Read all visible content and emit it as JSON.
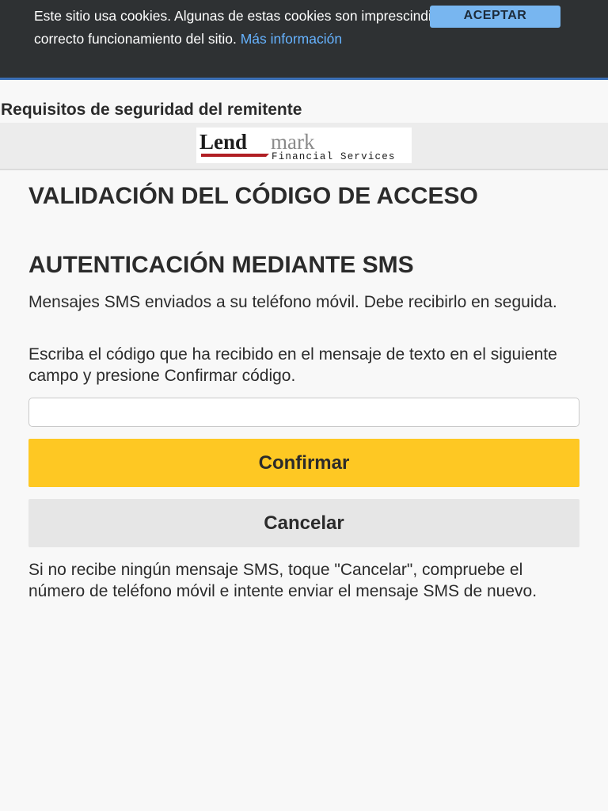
{
  "cookie_bar": {
    "text": "Este sitio usa cookies. Algunas de estas cookies son imprescindibles para el correcto funcionamiento del sitio.",
    "link_label": "Más información",
    "accept_label": "ACEPTAR"
  },
  "header": {
    "security_title": "Requisitos de seguridad del remitente"
  },
  "logo": {
    "brand_bold": "Lend",
    "brand_light": "mark",
    "tagline": "Financial Services"
  },
  "main": {
    "title": "VALIDACIÓN DEL CÓDIGO DE ACCESO",
    "subtitle": "AUTENTICACIÓN MEDIANTE SMS",
    "sms_sent_text": "Mensajes SMS enviados a su teléfono móvil. Debe recibirlo en seguida.",
    "instruction_text": "Escriba el código que ha recibido en el mensaje de texto en el siguiente campo y presione Confirmar código.",
    "code_input_value": "",
    "confirm_label": "Confirmar",
    "cancel_label": "Cancelar",
    "help_text": "Si no recibe ningún mensaje SMS, toque \"Cancelar\", compruebe el número de teléfono móvil e intente enviar el mensaje SMS de nuevo."
  },
  "colors": {
    "confirm_button": "#fec823",
    "cancel_button": "#e6e6e6",
    "cookie_bar": "#2e3133",
    "accept_button": "#78b6f0",
    "link": "#66b3ff",
    "logo_underline": "#b01e23"
  }
}
